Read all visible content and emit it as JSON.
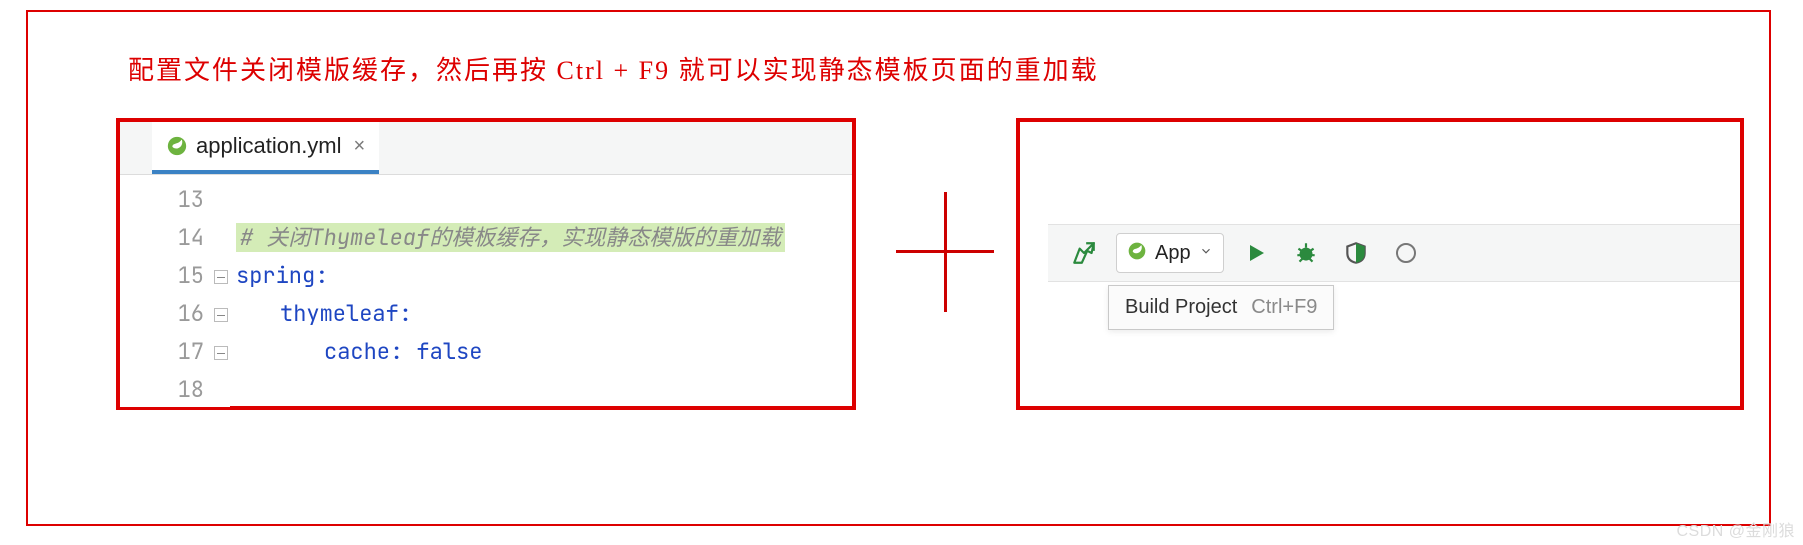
{
  "annotation": "配置文件关闭模版缓存，然后再按 Ctrl + F9 就可以实现静态模板页面的重加载",
  "editor": {
    "tab": {
      "filename": "application.yml",
      "close_glyph": "×"
    },
    "gutter": [
      "13",
      "14",
      "15",
      "16",
      "17",
      "18"
    ],
    "code": {
      "comment_hash": "#",
      "comment_text": " 关闭Thymeleaf的模板缓存，实现静态模版的重加载",
      "l1_key": "spring",
      "l2_key": "thymeleaf",
      "l3_key": "cache",
      "l3_val": "false",
      "colon": ":"
    }
  },
  "toolbar": {
    "run_config": "App",
    "tooltip_label": "Build Project",
    "tooltip_shortcut": "Ctrl+F9"
  },
  "watermark": "CSDN @金刚狼"
}
